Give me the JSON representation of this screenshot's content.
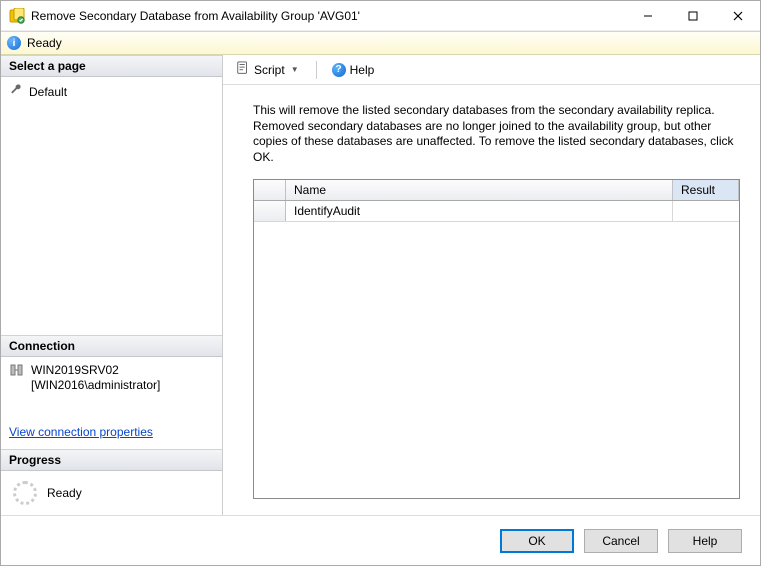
{
  "window": {
    "title": "Remove Secondary Database from Availability Group 'AVG01'"
  },
  "ready_strip": {
    "label": "Ready"
  },
  "left": {
    "select_page_header": "Select a page",
    "pages": [
      {
        "label": "Default"
      }
    ],
    "connection_header": "Connection",
    "connection": {
      "server": "WIN2019SRV02",
      "user": "[WIN2016\\administrator]"
    },
    "view_connection_link": "View connection properties",
    "progress_header": "Progress",
    "progress_status": "Ready"
  },
  "toolbar": {
    "script_label": "Script",
    "help_label": "Help"
  },
  "main": {
    "description": "This will remove the listed secondary databases from the secondary availability replica. Removed secondary databases are no longer joined to the availability group, but other copies of these databases are unaffected. To remove the listed secondary databases, click OK.",
    "columns": {
      "name": "Name",
      "result": "Result"
    },
    "rows": [
      {
        "name": "IdentifyAudit",
        "result": ""
      }
    ]
  },
  "footer": {
    "ok": "OK",
    "cancel": "Cancel",
    "help": "Help"
  }
}
